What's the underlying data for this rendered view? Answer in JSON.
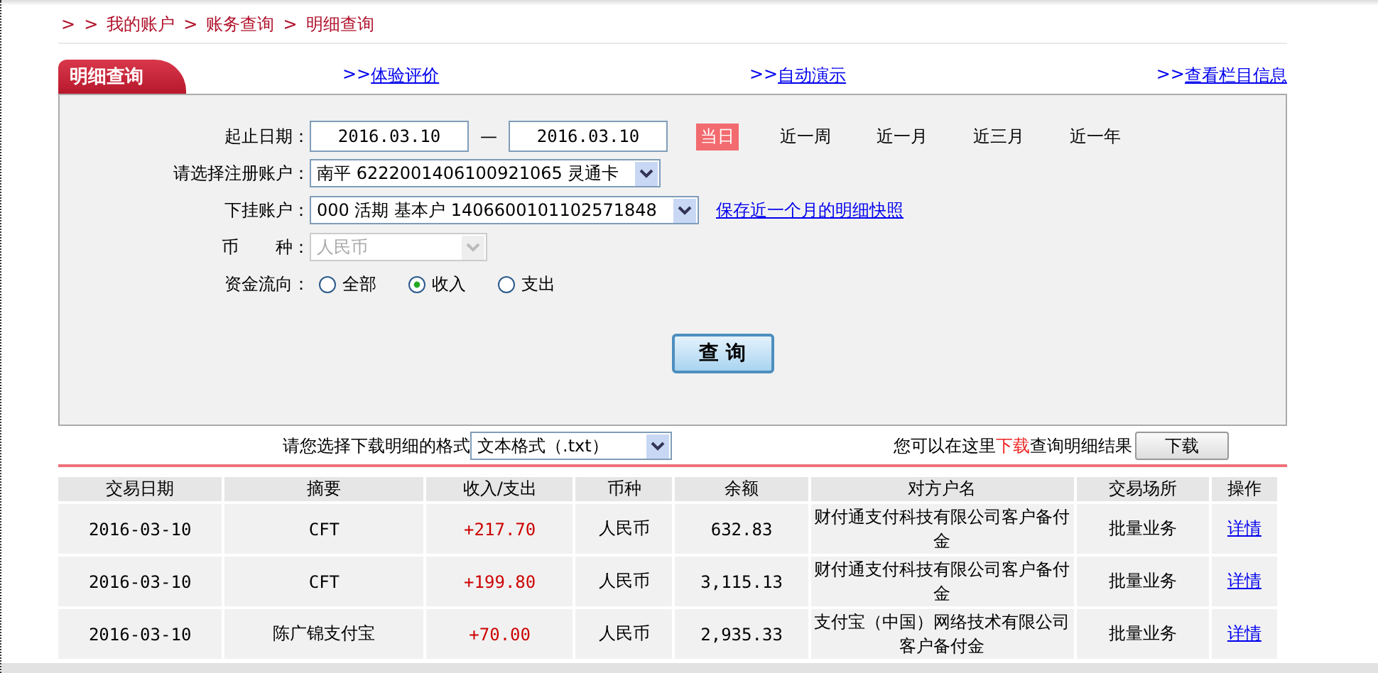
{
  "breadcrumb": [
    ">",
    ">",
    "我的账户",
    ">",
    "账务查询",
    ">",
    "明细查询"
  ],
  "tab": {
    "title": "明细查询"
  },
  "top_links": [
    {
      "arrows": ">>",
      "label": "体验评价"
    },
    {
      "arrows": ">>",
      "label": "自动演示"
    },
    {
      "arrows": ">>",
      "label": "查看栏目信息"
    }
  ],
  "form": {
    "date_label": "起止日期：",
    "start_date": "2016.03.10",
    "separator": "—",
    "end_date": "2016.03.10",
    "periods": [
      {
        "label": "当日",
        "selected": true
      },
      {
        "label": "近一周",
        "selected": false
      },
      {
        "label": "近一月",
        "selected": false
      },
      {
        "label": "近三月",
        "selected": false
      },
      {
        "label": "近一年",
        "selected": false
      }
    ],
    "account_label": "请选择注册账户：",
    "account": "南平 6222001406100921065 灵通卡",
    "sub_label": "下挂账户：",
    "sub_account": "000 活期 基本户 1406600101102571848",
    "snapshot_link": "保存近一个月的明细快照",
    "currency_label_1": "币",
    "currency_label_2": "种：",
    "currency": "人民币",
    "currency_disabled": true,
    "flow_label": "资金流向：",
    "flows": [
      {
        "label": "全部",
        "selected": false
      },
      {
        "label": "收入",
        "selected": true
      },
      {
        "label": "支出",
        "selected": false
      }
    ],
    "query_button": "查 询"
  },
  "download": {
    "format_label": "请您选择下载明细的格式",
    "format": "文本格式（.txt）",
    "hint_before": "您可以在这里",
    "hint_link": "下载",
    "hint_after": "查询明细结果",
    "button": "下载"
  },
  "table": {
    "columns": [
      "交易日期",
      "摘要",
      "收入/支出",
      "币种",
      "余额",
      "对方户名",
      "交易场所",
      "操作"
    ],
    "rows": [
      {
        "cells": [
          "2016-03-10",
          "CFT",
          "+217.70",
          "人民币",
          "632.83",
          "财付通支付科技有限公司客户备付金",
          "批量业务",
          "详情"
        ]
      },
      {
        "cells": [
          "2016-03-10",
          "CFT",
          "+199.80",
          "人民币",
          "3,115.13",
          "财付通支付科技有限公司客户备付金",
          "批量业务",
          "详情"
        ]
      },
      {
        "cells": [
          "2016-03-10",
          "陈广锦支付宝",
          "+70.00",
          "人民币",
          "2,935.33",
          "支付宝（中国）网络技术有限公司客户备付金",
          "批量业务",
          "详情"
        ]
      }
    ]
  }
}
